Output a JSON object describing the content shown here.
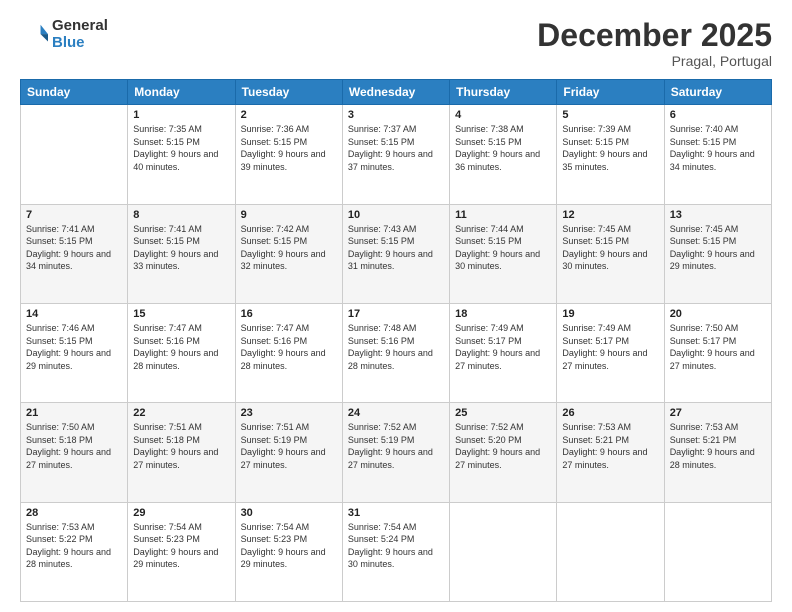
{
  "logo": {
    "general": "General",
    "blue": "Blue"
  },
  "title": "December 2025",
  "location": "Pragal, Portugal",
  "days_of_week": [
    "Sunday",
    "Monday",
    "Tuesday",
    "Wednesday",
    "Thursday",
    "Friday",
    "Saturday"
  ],
  "weeks": [
    [
      {
        "day": "",
        "sunrise": "",
        "sunset": "",
        "daylight": ""
      },
      {
        "day": "1",
        "sunrise": "Sunrise: 7:35 AM",
        "sunset": "Sunset: 5:15 PM",
        "daylight": "Daylight: 9 hours and 40 minutes."
      },
      {
        "day": "2",
        "sunrise": "Sunrise: 7:36 AM",
        "sunset": "Sunset: 5:15 PM",
        "daylight": "Daylight: 9 hours and 39 minutes."
      },
      {
        "day": "3",
        "sunrise": "Sunrise: 7:37 AM",
        "sunset": "Sunset: 5:15 PM",
        "daylight": "Daylight: 9 hours and 37 minutes."
      },
      {
        "day": "4",
        "sunrise": "Sunrise: 7:38 AM",
        "sunset": "Sunset: 5:15 PM",
        "daylight": "Daylight: 9 hours and 36 minutes."
      },
      {
        "day": "5",
        "sunrise": "Sunrise: 7:39 AM",
        "sunset": "Sunset: 5:15 PM",
        "daylight": "Daylight: 9 hours and 35 minutes."
      },
      {
        "day": "6",
        "sunrise": "Sunrise: 7:40 AM",
        "sunset": "Sunset: 5:15 PM",
        "daylight": "Daylight: 9 hours and 34 minutes."
      }
    ],
    [
      {
        "day": "7",
        "sunrise": "Sunrise: 7:41 AM",
        "sunset": "Sunset: 5:15 PM",
        "daylight": "Daylight: 9 hours and 34 minutes."
      },
      {
        "day": "8",
        "sunrise": "Sunrise: 7:41 AM",
        "sunset": "Sunset: 5:15 PM",
        "daylight": "Daylight: 9 hours and 33 minutes."
      },
      {
        "day": "9",
        "sunrise": "Sunrise: 7:42 AM",
        "sunset": "Sunset: 5:15 PM",
        "daylight": "Daylight: 9 hours and 32 minutes."
      },
      {
        "day": "10",
        "sunrise": "Sunrise: 7:43 AM",
        "sunset": "Sunset: 5:15 PM",
        "daylight": "Daylight: 9 hours and 31 minutes."
      },
      {
        "day": "11",
        "sunrise": "Sunrise: 7:44 AM",
        "sunset": "Sunset: 5:15 PM",
        "daylight": "Daylight: 9 hours and 30 minutes."
      },
      {
        "day": "12",
        "sunrise": "Sunrise: 7:45 AM",
        "sunset": "Sunset: 5:15 PM",
        "daylight": "Daylight: 9 hours and 30 minutes."
      },
      {
        "day": "13",
        "sunrise": "Sunrise: 7:45 AM",
        "sunset": "Sunset: 5:15 PM",
        "daylight": "Daylight: 9 hours and 29 minutes."
      }
    ],
    [
      {
        "day": "14",
        "sunrise": "Sunrise: 7:46 AM",
        "sunset": "Sunset: 5:15 PM",
        "daylight": "Daylight: 9 hours and 29 minutes."
      },
      {
        "day": "15",
        "sunrise": "Sunrise: 7:47 AM",
        "sunset": "Sunset: 5:16 PM",
        "daylight": "Daylight: 9 hours and 28 minutes."
      },
      {
        "day": "16",
        "sunrise": "Sunrise: 7:47 AM",
        "sunset": "Sunset: 5:16 PM",
        "daylight": "Daylight: 9 hours and 28 minutes."
      },
      {
        "day": "17",
        "sunrise": "Sunrise: 7:48 AM",
        "sunset": "Sunset: 5:16 PM",
        "daylight": "Daylight: 9 hours and 28 minutes."
      },
      {
        "day": "18",
        "sunrise": "Sunrise: 7:49 AM",
        "sunset": "Sunset: 5:17 PM",
        "daylight": "Daylight: 9 hours and 27 minutes."
      },
      {
        "day": "19",
        "sunrise": "Sunrise: 7:49 AM",
        "sunset": "Sunset: 5:17 PM",
        "daylight": "Daylight: 9 hours and 27 minutes."
      },
      {
        "day": "20",
        "sunrise": "Sunrise: 7:50 AM",
        "sunset": "Sunset: 5:17 PM",
        "daylight": "Daylight: 9 hours and 27 minutes."
      }
    ],
    [
      {
        "day": "21",
        "sunrise": "Sunrise: 7:50 AM",
        "sunset": "Sunset: 5:18 PM",
        "daylight": "Daylight: 9 hours and 27 minutes."
      },
      {
        "day": "22",
        "sunrise": "Sunrise: 7:51 AM",
        "sunset": "Sunset: 5:18 PM",
        "daylight": "Daylight: 9 hours and 27 minutes."
      },
      {
        "day": "23",
        "sunrise": "Sunrise: 7:51 AM",
        "sunset": "Sunset: 5:19 PM",
        "daylight": "Daylight: 9 hours and 27 minutes."
      },
      {
        "day": "24",
        "sunrise": "Sunrise: 7:52 AM",
        "sunset": "Sunset: 5:19 PM",
        "daylight": "Daylight: 9 hours and 27 minutes."
      },
      {
        "day": "25",
        "sunrise": "Sunrise: 7:52 AM",
        "sunset": "Sunset: 5:20 PM",
        "daylight": "Daylight: 9 hours and 27 minutes."
      },
      {
        "day": "26",
        "sunrise": "Sunrise: 7:53 AM",
        "sunset": "Sunset: 5:21 PM",
        "daylight": "Daylight: 9 hours and 27 minutes."
      },
      {
        "day": "27",
        "sunrise": "Sunrise: 7:53 AM",
        "sunset": "Sunset: 5:21 PM",
        "daylight": "Daylight: 9 hours and 28 minutes."
      }
    ],
    [
      {
        "day": "28",
        "sunrise": "Sunrise: 7:53 AM",
        "sunset": "Sunset: 5:22 PM",
        "daylight": "Daylight: 9 hours and 28 minutes."
      },
      {
        "day": "29",
        "sunrise": "Sunrise: 7:54 AM",
        "sunset": "Sunset: 5:23 PM",
        "daylight": "Daylight: 9 hours and 29 minutes."
      },
      {
        "day": "30",
        "sunrise": "Sunrise: 7:54 AM",
        "sunset": "Sunset: 5:23 PM",
        "daylight": "Daylight: 9 hours and 29 minutes."
      },
      {
        "day": "31",
        "sunrise": "Sunrise: 7:54 AM",
        "sunset": "Sunset: 5:24 PM",
        "daylight": "Daylight: 9 hours and 30 minutes."
      },
      {
        "day": "",
        "sunrise": "",
        "sunset": "",
        "daylight": ""
      },
      {
        "day": "",
        "sunrise": "",
        "sunset": "",
        "daylight": ""
      },
      {
        "day": "",
        "sunrise": "",
        "sunset": "",
        "daylight": ""
      }
    ]
  ]
}
